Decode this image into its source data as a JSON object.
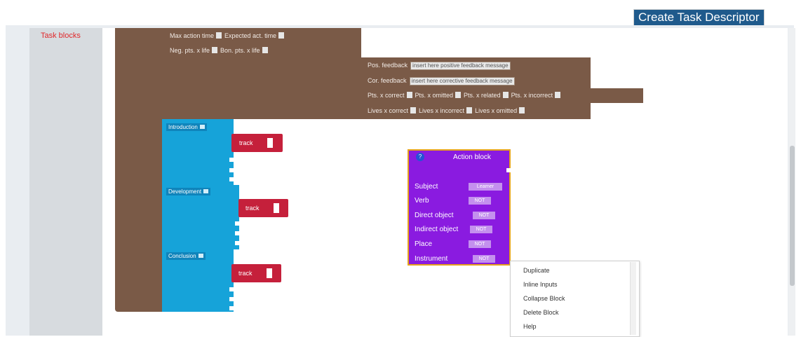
{
  "header": {
    "create_button": "Create Task Descriptor"
  },
  "toolbox": {
    "category": "Task blocks"
  },
  "task_block": {
    "row1": {
      "max_action_time": "Max action time",
      "expected_act_time": "Expected act. time"
    },
    "row2": {
      "neg_pts_x_life": "Neg. pts. x life",
      "bon_pts_x_life": "Bon. pts. x life"
    },
    "pos_feedback": {
      "label": "Pos. feedback",
      "value": "insert here positive feedback message"
    },
    "cor_feedback": {
      "label": "Cor. feedback",
      "value": "insert here corrective feedback message"
    },
    "pts_row": [
      "Pts. x correct",
      "Pts. x omitted",
      "Pts. x related",
      "Pts. x incorrect"
    ],
    "lives_row": [
      "Lives x correct",
      "Lives x incorrect",
      "Lives x omitted"
    ]
  },
  "sections": [
    {
      "label": "Introduction",
      "track": "track"
    },
    {
      "label": "Development",
      "track": "track"
    },
    {
      "label": "Conclusion",
      "track": "track"
    }
  ],
  "action_block": {
    "title": "Action block",
    "info": "?",
    "rows": [
      {
        "label": "Subject",
        "value": "Learner"
      },
      {
        "label": "Verb",
        "value": "NOT"
      },
      {
        "label": "Direct object",
        "value": "NOT"
      },
      {
        "label": "Indirect object",
        "value": "NOT"
      },
      {
        "label": "Place",
        "value": "NOT"
      },
      {
        "label": "Instrument",
        "value": "NOT"
      }
    ]
  },
  "context_menu": {
    "items": [
      "Duplicate",
      "Inline Inputs",
      "Collapse Block",
      "Delete Block",
      "Help"
    ]
  },
  "colors": {
    "task_block": "#7a5a47",
    "section_block": "#16a3d9",
    "track_block": "#c5203b",
    "action_block": "#8a1be0",
    "selection_outline": "#e6a21b"
  }
}
